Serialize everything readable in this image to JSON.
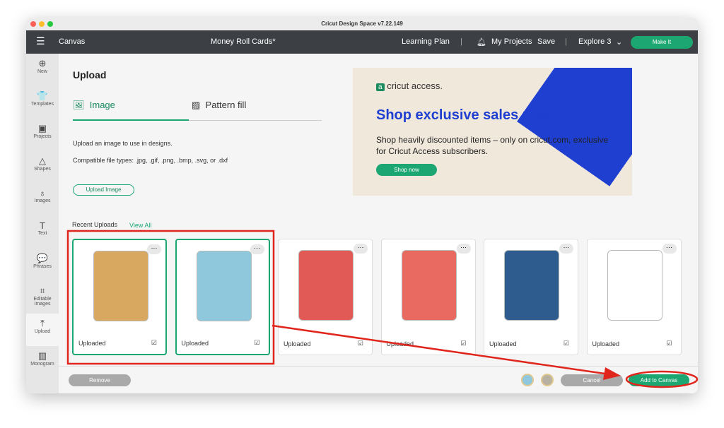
{
  "window": {
    "title": "Cricut Design Space  v7.22.149"
  },
  "toolbar": {
    "menu": "Canvas",
    "project": "Money Roll Cards*",
    "learning": "Learning Plan",
    "my_projects": "My Projects",
    "save": "Save",
    "machine": "Explore 3",
    "make_it": "Make It"
  },
  "sidebar": {
    "items": [
      {
        "label": "New",
        "icon": "⊕"
      },
      {
        "label": "Templates",
        "icon": "👕"
      },
      {
        "label": "Projects",
        "icon": "▣"
      },
      {
        "label": "Shapes",
        "icon": "△"
      },
      {
        "label": "Images",
        "icon": "♁"
      },
      {
        "label": "Text",
        "icon": "T"
      },
      {
        "label": "Phrases",
        "icon": "💬"
      },
      {
        "label": "Editable Images",
        "icon": "⌗"
      },
      {
        "label": "Upload",
        "icon": "⤒"
      },
      {
        "label": "Monogram",
        "icon": "▥"
      }
    ]
  },
  "upload": {
    "title": "Upload",
    "tabs": [
      {
        "label": "Image"
      },
      {
        "label": "Pattern fill"
      }
    ],
    "desc": "Upload an image to use in designs.",
    "types": "Compatible file types: .jpg, .gif, .png, .bmp, .svg, or .dxf",
    "button": "Upload Image",
    "recent": "Recent Uploads",
    "view_all": "View All"
  },
  "banner": {
    "brand": "cricut access.",
    "headline": "Shop exclusive sales now",
    "body": "Shop heavily discounted items – only on cricut.com, exclusive for Cricut Access subscribers.",
    "cta": "Shop now"
  },
  "cards": [
    {
      "label": "Uploaded",
      "selected": true,
      "color": "#d9a860"
    },
    {
      "label": "Uploaded",
      "selected": true,
      "color": "#8fc8dc"
    },
    {
      "label": "Uploaded",
      "selected": false,
      "color": "#e25a55"
    },
    {
      "label": "Uploaded",
      "selected": false,
      "color": "#e86a60"
    },
    {
      "label": "Uploaded",
      "selected": false,
      "color": "#2f5c8e"
    },
    {
      "label": "Uploaded",
      "selected": false,
      "color": "#ffffff"
    }
  ],
  "footer": {
    "remove": "Remove",
    "cancel": "Cancel",
    "add": "Add to Canvas"
  },
  "colors": {
    "accent": "#1ba672",
    "annotation": "#e0261c"
  }
}
